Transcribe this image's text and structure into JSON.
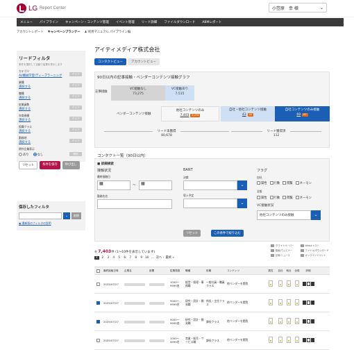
{
  "header": {
    "brand": "LG",
    "app_name": "Report Center",
    "user_label": "小笠原　幸 様"
  },
  "mainnav": [
    "メニュー",
    "パイプライン",
    "キャンペーン・コンテンツ管理",
    "イベント管理",
    "リード詳細",
    "ファイルダウンロード",
    "ABMレポート"
  ],
  "subnav": [
    "アカウントレポート",
    "キャンペーンプランナー",
    "利用マニュアル パイプライン編"
  ],
  "sidebar": {
    "title": "リードフィルタ",
    "note": "条件を選択して自動で結果を表示します",
    "items": [
      {
        "label": "カテゴリ",
        "link": "AI/機械学習/ディープラーニング",
        "clear": "クリア"
      },
      {
        "label": "業種",
        "link": "選択する",
        "clear": "クリア"
      },
      {
        "label": "職種",
        "link": "選択する",
        "clear": "クリア"
      },
      {
        "label": "従業員数",
        "link": "選択する",
        "clear": "クリア"
      },
      {
        "label": "年商規模",
        "link": "選択する",
        "clear": "クリア"
      },
      {
        "label": "役職クラス",
        "link": "選択する",
        "clear": "クリア"
      },
      {
        "label": "勤務地",
        "link": "選択する",
        "clear": "クリア"
      }
    ],
    "scope_label": "除外企業表示",
    "radio_on": "あり",
    "radio_off": "なし",
    "radio_clear": "削除",
    "btn_reset": "リセット",
    "btn_save": "条件を保存",
    "btn_recall": "呼び出し"
  },
  "saved": {
    "title": "保存したフィルタ",
    "delete": "削除",
    "link": "最新版のフィルタの説明"
  },
  "main": {
    "company": "アイティメディア株式会社",
    "tab_active": "コンタクトビュー",
    "tab_inactive": "アカウントビュー"
  },
  "graph": {
    "title": "90日以内の記事接触・ベンダーコンテンツ接触グラフ",
    "row_label": "記事接触",
    "vc_none_label": "VC接触なし",
    "vc_none_value": "73,275",
    "vc_yes_label": "VC接触あり",
    "vc_yes_value": "7,515",
    "vendor_label": "ベンダーコンテンツ接触",
    "v_only_label": "他社コンテンツのみ",
    "v_only_value": "7,403",
    "v_only_tag": "6,476",
    "vm_both_label": "自社・他社コンテンツ接触",
    "vm_both_value": "43",
    "vm_both_tag": "41",
    "m_only_label": "自社コンテンツのみ接触",
    "m_only_value": "69",
    "m_only_tag": "67",
    "lead_total_label": "リード未獲得",
    "lead_total_value": "80,678",
    "lead_comp_label": "リード獲得済",
    "lead_comp_value": "112"
  },
  "contact": {
    "title": "コンタクト一覧（90日以内）",
    "adv_search": "詳細検索",
    "cond_title": "接触状況",
    "last_date_label": "最終接触日",
    "tilde": "~",
    "company_name_label": "勤務先名",
    "bant_title": "BANT",
    "auth_label": "決裁",
    "budget_label": "導入予定",
    "flag_title": "フラグ",
    "flag_self": "自社",
    "flag_other": "全般",
    "flag_opts": [
      "属性",
      "行動",
      "閲覧",
      "ネーモン"
    ],
    "vc_status_label": "VC接触状況",
    "vc_status_value": "他社コンテンツのみ接触",
    "reset": "リセット",
    "search": "この条件で絞り込む"
  },
  "results": {
    "count": "7,403",
    "unit": "件",
    "range": "(1〜10件を表示しています)",
    "pages": [
      "1",
      "2",
      "3",
      "4",
      "5",
      "6",
      "7",
      "8",
      "9",
      "10"
    ],
    "ellipsis": "…",
    "next": "次へ ›",
    "last": "最終 »",
    "legend": [
      "ホワイトペーパー",
      "Webキャスト",
      "動画/ウェビナー",
      "ファイル/ダウンロード",
      "記事/ニュース",
      "オンラインイベント"
    ]
  },
  "table": {
    "headers": [
      "",
      "最終接触日時",
      "企業名",
      "部署",
      "従業員数",
      "職種",
      "役職",
      "コンテンツ",
      "属性",
      "自社",
      "他社",
      "全般",
      "詳細"
    ],
    "rows": [
      {
        "checked": false,
        "date": "2025/07/27",
        "emp": "1000～9999名",
        "job": "経営・経理・事務職",
        "role": "一般社員・職員クラス",
        "content": "他ベンダーを閲覧"
      },
      {
        "checked": true,
        "date": "2025/07/27",
        "emp": "5000～9999名",
        "job": "研究・設計・開発職",
        "role": "係長・主任クラス",
        "content": "他ベンダーを閲覧"
      },
      {
        "checked": true,
        "date": "2025/07/27",
        "emp": "5000～9999名",
        "job": "研究・設計・開発職",
        "role": "課長クラス",
        "content": "他ベンダーを閲覧"
      },
      {
        "checked": false,
        "date": "2025/07/27",
        "emp": "1000～9999名",
        "job": "営業・販売・サービス職",
        "role": "課長クラス",
        "content": "他ベンダーを閲覧"
      },
      {
        "checked": true,
        "date": "2025/07/27",
        "emp": "50～99名",
        "job": "その他専門職",
        "role": "係長・主任クラス",
        "content": "他ベンダーを閲覧"
      }
    ]
  },
  "colors": {
    "brand": "#a50034",
    "accent": "#1a5fb4",
    "tag": "#e06a1a"
  }
}
